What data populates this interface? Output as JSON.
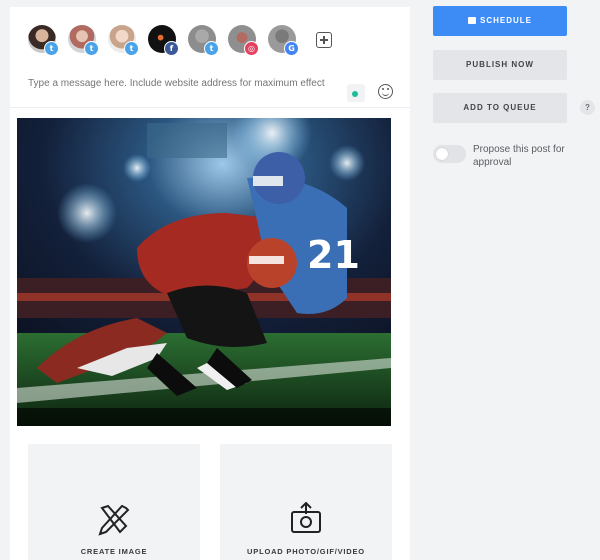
{
  "composer": {
    "message_placeholder": "Type a message here. Include website address for maximum effect",
    "accounts": [
      {
        "avatar": "avatar-woman-dark",
        "network": "twitter",
        "badge_color": "#4aa3e8",
        "badge_glyph": "t"
      },
      {
        "avatar": "avatar-woman-light",
        "network": "twitter",
        "badge_color": "#4aa3e8",
        "badge_glyph": "t"
      },
      {
        "avatar": "avatar-man-beige",
        "network": "twitter",
        "badge_color": "#4aa3e8",
        "badge_glyph": "t"
      },
      {
        "avatar": "avatar-logo-black",
        "network": "facebook",
        "badge_color": "#3b5998",
        "badge_glyph": "f"
      },
      {
        "avatar": "avatar-grey",
        "network": "twitter",
        "badge_color": "#4aa3e8",
        "badge_glyph": "t"
      },
      {
        "avatar": "avatar-grey-red",
        "network": "instagram",
        "badge_color": "#e4405f",
        "badge_glyph": "◎"
      },
      {
        "avatar": "avatar-grey-dark",
        "network": "google",
        "badge_color": "#4285f4",
        "badge_glyph": "G"
      }
    ],
    "image_alt": "American football tackle in a stadium",
    "tiles": {
      "create_image_label": "CREATE IMAGE",
      "upload_label": "UPLOAD PHOTO/GIF/VIDEO"
    }
  },
  "actions": {
    "schedule_label": "SCHEDULE",
    "publish_now_label": "PUBLISH NOW",
    "add_to_queue_label": "ADD TO QUEUE",
    "help_label": "?",
    "approval_label": "Propose this post for approval",
    "approval_enabled": false
  },
  "colors": {
    "primary": "#3d8cf5",
    "status_dot": "#1bbc9b"
  }
}
